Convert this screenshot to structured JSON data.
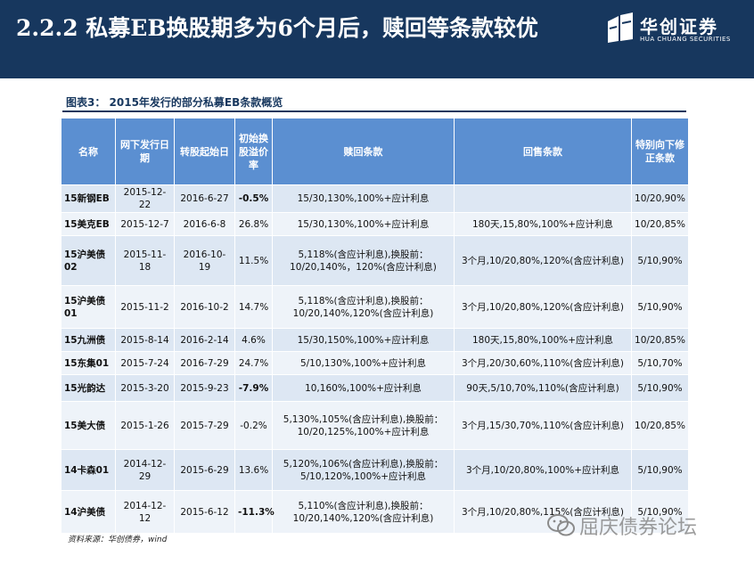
{
  "slide": {
    "title": "2.2.2 私募EB换股期多为6个月后，赎回等条款较优",
    "logo_name": "华创证券",
    "logo_sub": "HUA CHUANG SECURITIES"
  },
  "figure": {
    "caption": "图表3： 2015年发行的部分私募EB条款概览",
    "source": "资料来源：华创债券，wind"
  },
  "table": {
    "headers": [
      "名称",
      "网下发行日期",
      "转股起始日",
      "初始换股溢价率",
      "赎回条款",
      "回售条款",
      "特别向下修正条款"
    ],
    "rows": [
      {
        "name": "15新钢EB",
        "issue": "2015-12-22",
        "start": "2016-6-27",
        "premium": "-0.5%",
        "redeem": "15/30,130%,100%+应计利息",
        "putback": "",
        "reset": "10/20,90%"
      },
      {
        "name": "15美克EB",
        "issue": "2015-12-7",
        "start": "2016-6-8",
        "premium": "26.8%",
        "redeem": "15/30,130%,100%+应计利息",
        "putback": "180天,15,80%,100%+应计利息",
        "reset": "10/20,85%"
      },
      {
        "name": "15沪美债02",
        "issue": "2015-11-18",
        "start": "2016-10-19",
        "premium": "11.5%",
        "redeem": "5,118%(含应计利息),换股前：10/20,140%，120%(含应计利息)",
        "putback": "3个月,10/20,80%,120%(含应计利息)",
        "reset": "5/10,90%"
      },
      {
        "name": "15沪美债01",
        "issue": "2015-11-2",
        "start": "2016-10-2",
        "premium": "14.7%",
        "redeem": "5,118%(含应计利息),换股前：10/20,140%,120%(含应计利息)",
        "putback": "3个月,10/20,80%,120%(含应计利息)",
        "reset": "5/10,90%"
      },
      {
        "name": "15九洲债",
        "issue": "2015-8-14",
        "start": "2016-2-14",
        "premium": "4.6%",
        "redeem": "15/30,150%,100%+应计利息",
        "putback": "180天,15,80%,100%+应计利息",
        "reset": "10/20,85%"
      },
      {
        "name": "15东集01",
        "issue": "2015-7-24",
        "start": "2016-7-29",
        "premium": "24.7%",
        "redeem": "5/10,130%,100%+应计利息",
        "putback": "3个月,20/30,60%,110%(含应计利息)",
        "reset": "5/10,70%"
      },
      {
        "name": "15光韵达",
        "issue": "2015-3-20",
        "start": "2015-9-23",
        "premium": "-7.9%",
        "redeem": "10,160%,100%+应计利息",
        "putback": "90天,5/10,70%,110%(含应计利息)",
        "reset": "5/10,90%"
      },
      {
        "name": "15美大债",
        "issue": "2015-1-26",
        "start": "2015-7-29",
        "premium": "-0.2%",
        "redeem": "5,130%,105%(含应计利息),换股前：10/20,125%,100%+应计利息",
        "putback": "3个月,15/30,70%,110%(含应计利息)",
        "reset": "10/20,85%"
      },
      {
        "name": "14卡森01",
        "issue": "2014-12-29",
        "start": "2015-6-29",
        "premium": "13.6%",
        "redeem": "5,120%,106%(含应计利息),换股前：5/10,120%,100%+应计利息",
        "putback": "3个月,10/20,80%,100%+应计利息",
        "reset": "5/10,90%"
      },
      {
        "name": "14沪美债",
        "issue": "2014-12-12",
        "start": "2015-6-12",
        "premium": "-11.3%",
        "redeem": "5,110%(含应计利息),换股前：10/20,140%,120%(含应计利息)",
        "putback": "3个月,10/20,80%,115%(含应计利息)",
        "reset": "5/10,90%"
      }
    ]
  },
  "watermark": {
    "text": "屈庆债券论坛",
    "icon": "wechat-icon"
  },
  "colors": {
    "header_bg": "#17375e",
    "table_header_bg": "#5b8fd1",
    "row_odd": "#dde7f3",
    "row_even": "#eef3f9"
  }
}
